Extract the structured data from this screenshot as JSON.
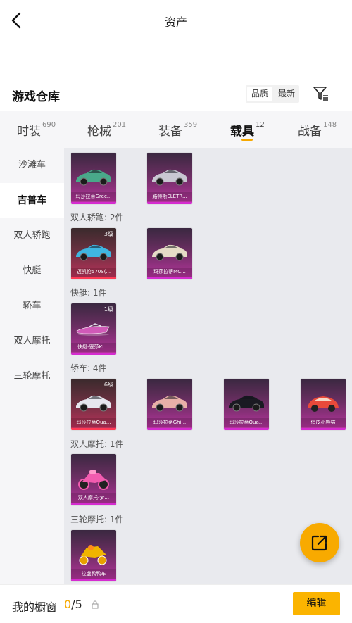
{
  "header": {
    "title": "资产"
  },
  "warehouse": {
    "title": "游戏仓库",
    "sort_options": [
      "品质",
      "最新"
    ],
    "sort_active": 0
  },
  "tabs": [
    {
      "label": "时装",
      "count": "690"
    },
    {
      "label": "枪械",
      "count": "201"
    },
    {
      "label": "装备",
      "count": "359"
    },
    {
      "label": "载具",
      "count": "12"
    },
    {
      "label": "战备",
      "count": "148"
    }
  ],
  "active_tab": 3,
  "sidebar": {
    "items": [
      {
        "label": "沙滩车"
      },
      {
        "label": "吉普车"
      },
      {
        "label": "双人轿跑"
      },
      {
        "label": "快艇"
      },
      {
        "label": "轿车"
      },
      {
        "label": "双人摩托"
      },
      {
        "label": "三轮摩托"
      }
    ],
    "active": 1
  },
  "sections": [
    {
      "label": "",
      "items": [
        {
          "name": "玛莎拉蒂Grec...",
          "level": "",
          "color": "#49a98a",
          "kind": "car"
        },
        {
          "name": "路特斯ELETR...",
          "level": "",
          "color": "#c9c7d2",
          "kind": "car"
        }
      ]
    },
    {
      "label": "双人轿跑: 2件",
      "items": [
        {
          "name": "迈凯伦570S(...",
          "level": "3级",
          "color": "#3fb6e0",
          "kind": "car",
          "orange": true
        },
        {
          "name": "玛莎拉蒂MC...",
          "level": "",
          "color": "#e5dcc6",
          "kind": "car"
        }
      ]
    },
    {
      "label": "快艇: 1件",
      "items": [
        {
          "name": "快艇-塞莎KL...",
          "level": "1级",
          "color": "#d05ab8",
          "kind": "boat"
        }
      ]
    },
    {
      "label": "轿车: 4件",
      "items": [
        {
          "name": "玛莎拉蒂Qua...",
          "level": "6级",
          "color": "#e6e6ee",
          "kind": "car",
          "orange": true
        },
        {
          "name": "玛莎拉蒂Ghi...",
          "level": "",
          "color": "#e8b0a8",
          "kind": "car"
        },
        {
          "name": "玛莎拉蒂Qua...",
          "level": "",
          "color": "#1a1a22",
          "kind": "car"
        },
        {
          "name": "俏皮小熊猫",
          "level": "",
          "color": "#e84a3a",
          "kind": "beetle"
        }
      ]
    },
    {
      "label": "双人摩托: 1件",
      "items": [
        {
          "name": "双人摩托-梦...",
          "level": "",
          "color": "#f25cb0",
          "kind": "moto"
        }
      ]
    },
    {
      "label": "三轮摩托: 1件",
      "items": [
        {
          "name": "拉盏鸭鸭车",
          "level": "",
          "color": "#f0b400",
          "kind": "trike"
        }
      ]
    }
  ],
  "bottom": {
    "label": "我的橱窗",
    "current": "0",
    "total": "/5",
    "edit_label": "编辑"
  },
  "colors": {
    "accent": "#f6a800",
    "card_purple": "#b8349e",
    "card_orange": "#ff3a55"
  }
}
